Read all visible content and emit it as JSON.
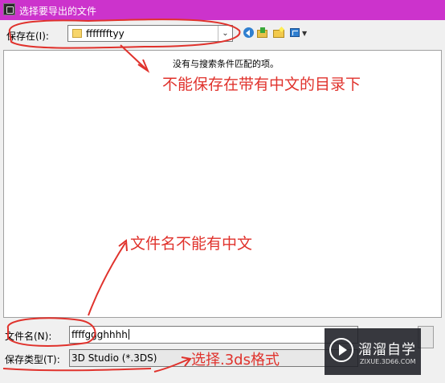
{
  "window": {
    "title": "选择要导出的文件"
  },
  "save_in": {
    "label": "保存在(I):",
    "value": "ffffffftyy"
  },
  "toolbar": {
    "icons": [
      "back-icon",
      "up-folder-icon",
      "new-folder-icon",
      "view-menu-icon"
    ]
  },
  "file_list": {
    "empty_message": "没有与搜索条件匹配的项。"
  },
  "file_name": {
    "label": "文件名(N):",
    "value": "ffffggghhhh"
  },
  "save_type": {
    "label": "保存类型(T):",
    "value": "3D Studio (*.3DS)"
  },
  "annotations": {
    "note1": "不能保存在带有中文的目录下",
    "note2": "文件名不能有中文",
    "note3": "选择.3ds格式",
    "color": "#e0322c"
  },
  "watermark": {
    "brand": "溜溜自学",
    "url": "ZIXUE.3D66.COM"
  },
  "colors": {
    "titlebar": "#cc33cc"
  }
}
